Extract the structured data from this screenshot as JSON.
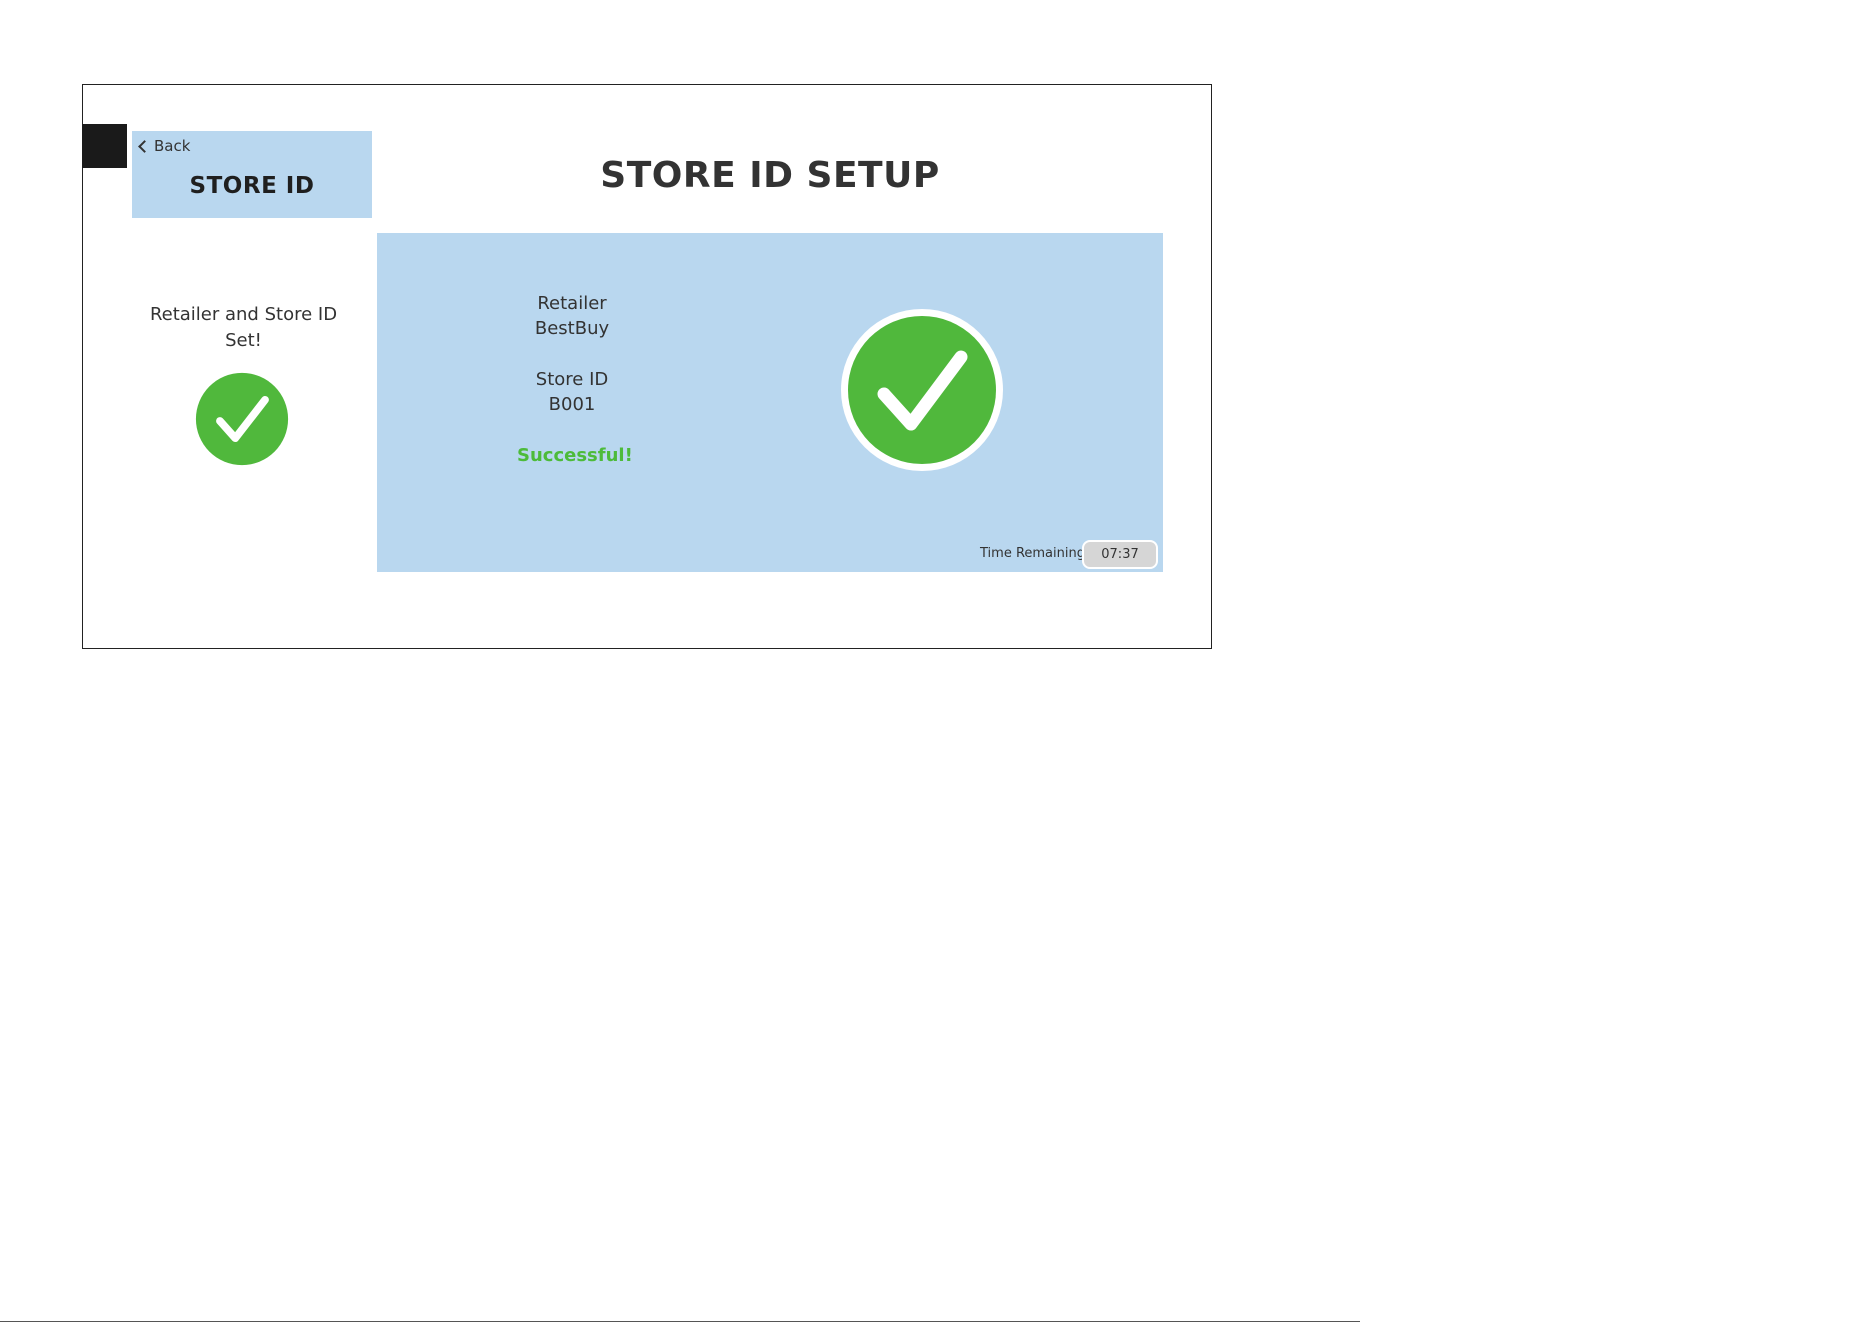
{
  "sidebar": {
    "back_label": "Back",
    "title": "STORE ID",
    "message_line1": "Retailer and Store ID",
    "message_line2": "Set!"
  },
  "main": {
    "title": "STORE ID SETUP",
    "retailer_label": "Retailer",
    "retailer_value": "BestBuy",
    "store_id_label": "Store ID",
    "store_id_value": "B001",
    "status": "Successful!"
  },
  "timer": {
    "label": "Time Remaining:",
    "value": "07:37"
  },
  "colors": {
    "panel_blue": "#b9d7ef",
    "success_green": "#4dbb3a",
    "check_green": "#50b83c"
  },
  "icons": {
    "back": "chevron-left-icon",
    "check": "check-circle-icon"
  }
}
